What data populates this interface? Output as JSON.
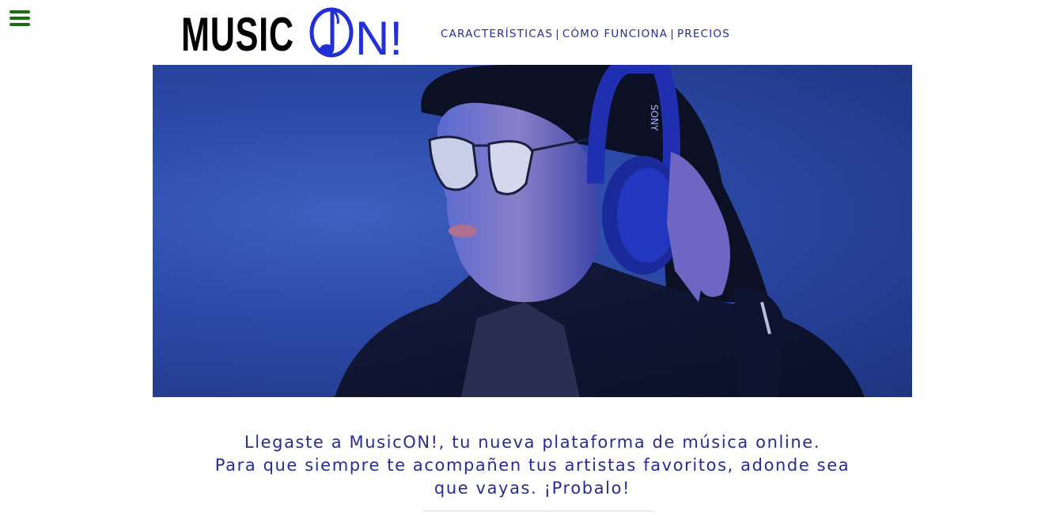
{
  "header": {
    "menu_icon": "hamburger-menu-icon",
    "logo": {
      "word1": "MUSIC",
      "word2": "ON!",
      "word1_color": "#000000",
      "word2_color": "#2230d8",
      "note_icon": "music-note-icon"
    },
    "nav": [
      {
        "label": "CARACTERÍSTICAS"
      },
      {
        "label": "CÓMO FUNCIONA"
      },
      {
        "label": "PRECIOS"
      }
    ],
    "nav_separator": "|",
    "nav_color": "#262c96"
  },
  "hero": {
    "image": "woman-with-headphones-and-sunglasses-photo",
    "headphone_brand": "SONY",
    "background_color": "#2f4fb0"
  },
  "intro": {
    "line1": "Llegaste a MusicON!, tu nueva plataforma de música online.",
    "line2": "Para que siempre te acompañen tus artistas favoritos, adonde sea que vayas. ¡Probalo!",
    "color": "#262c96"
  },
  "colors": {
    "accent_green": "#1a6e12",
    "brand_blue": "#2230d8"
  }
}
